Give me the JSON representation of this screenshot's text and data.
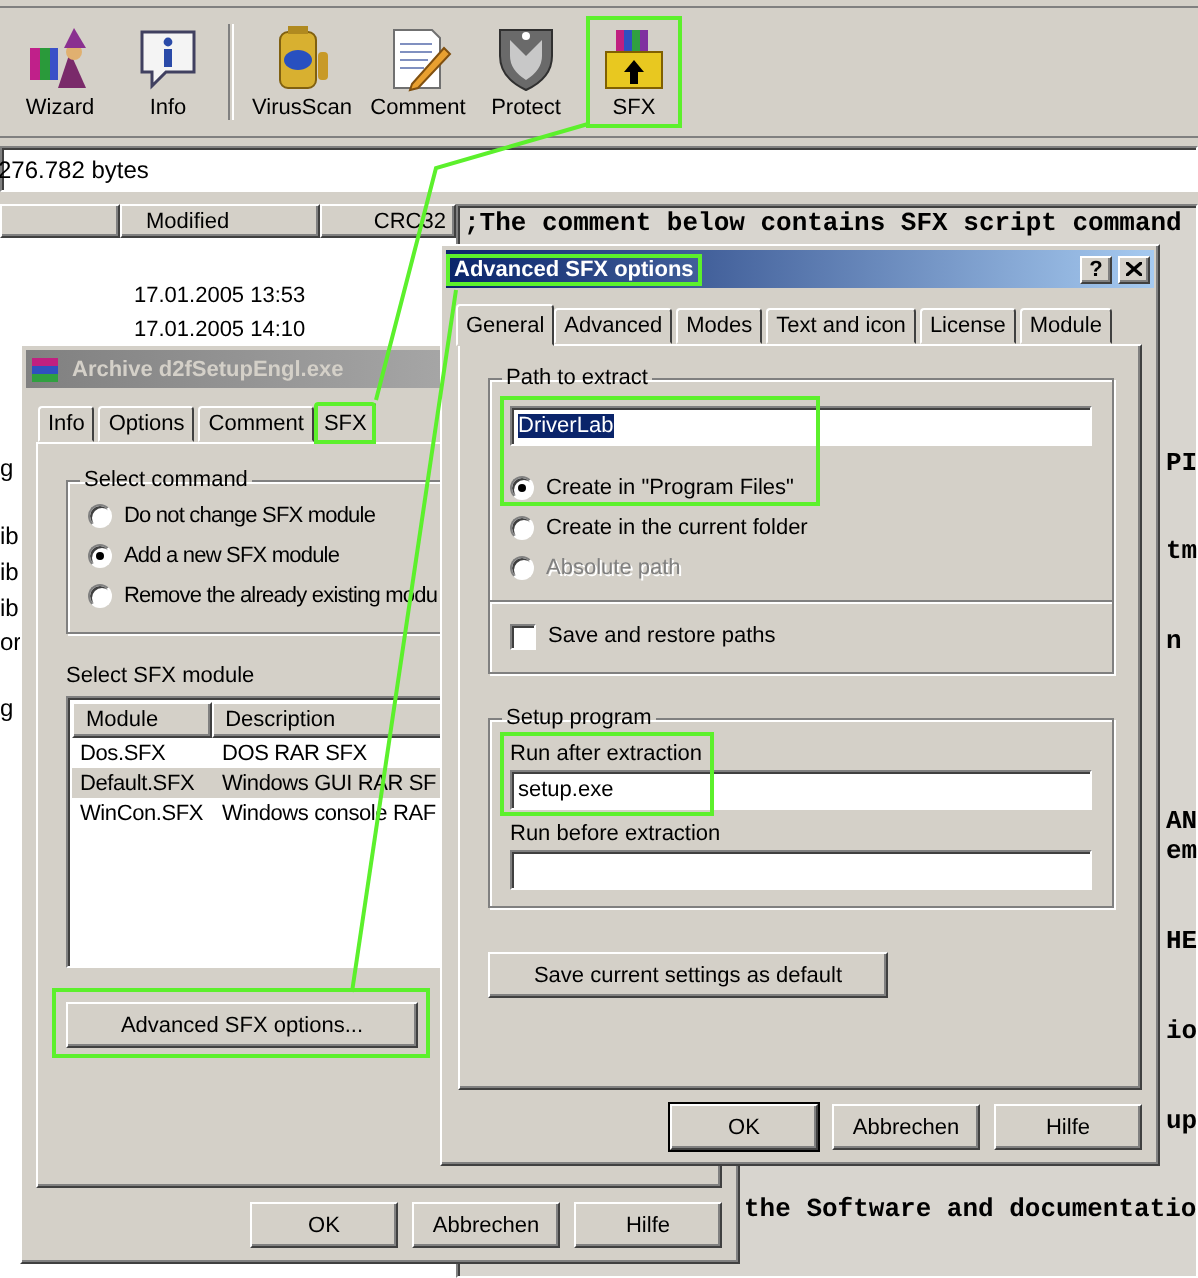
{
  "toolbar": {
    "groups": [
      {
        "buttons": [
          {
            "kind": "wizard",
            "label": "Wizard",
            "highlighted": false
          },
          {
            "kind": "info",
            "label": "Info",
            "highlighted": false
          }
        ]
      },
      {
        "buttons": [
          {
            "kind": "virusscan",
            "label": "VirusScan",
            "highlighted": false
          },
          {
            "kind": "comment",
            "label": "Comment",
            "highlighted": false
          },
          {
            "kind": "protect",
            "label": "Protect",
            "highlighted": false
          },
          {
            "kind": "sfx",
            "label": "SFX",
            "highlighted": true
          }
        ]
      }
    ]
  },
  "info_bar": {
    "text": "276.782 bytes"
  },
  "file_list": {
    "columns": [
      "Modified",
      "CRC32"
    ],
    "rows": [
      {
        "modified": "17.01.2005 13:53"
      },
      {
        "modified": "17.01.2005 14:10"
      }
    ],
    "cut_names": [
      "g",
      "ib",
      "ib",
      "ib",
      "or",
      "g"
    ]
  },
  "comment": {
    "first_line": ";The comment below contains SFX script command",
    "cut_lines": [
      "PI",
      "tm",
      "n",
      "AN",
      "em",
      "HE",
      "io",
      "up"
    ],
    "last_line": "the Software and documentatio"
  },
  "archive_dialog": {
    "title": "Archive d2fSetupEngl.exe",
    "active": false,
    "tabs": [
      {
        "label": "Info",
        "selected": false,
        "highlighted": false
      },
      {
        "label": "Options",
        "selected": false,
        "highlighted": false
      },
      {
        "label": "Comment",
        "selected": false,
        "highlighted": false
      },
      {
        "label": "SFX",
        "selected": true,
        "highlighted": true
      }
    ],
    "command_group": {
      "title": "Select command",
      "options": [
        {
          "label": "Do not change SFX module",
          "selected": false
        },
        {
          "label": "Add a new SFX module",
          "selected": true
        },
        {
          "label": "Remove the already existing modu",
          "selected": false
        }
      ]
    },
    "module_label": "Select SFX module",
    "module_list": {
      "columns": [
        "Module",
        "Description"
      ],
      "rows": [
        {
          "module": "Dos.SFX",
          "description": "DOS RAR SFX",
          "selected": false
        },
        {
          "module": "Default.SFX",
          "description": "Windows GUI RAR SF",
          "selected": true
        },
        {
          "module": "WinCon.SFX",
          "description": "Windows console RAF",
          "selected": false
        }
      ]
    },
    "advanced_button": {
      "label": "Advanced SFX options...",
      "highlighted": true
    },
    "buttons": [
      {
        "label": "OK",
        "default": false
      },
      {
        "label": "Abbrechen",
        "default": false
      },
      {
        "label": "Hilfe",
        "default": false
      }
    ]
  },
  "advanced_dialog": {
    "title": "Advanced SFX options",
    "active": true,
    "title_highlighted": true,
    "help_button": "?",
    "tabs": [
      {
        "label": "General",
        "selected": true
      },
      {
        "label": "Advanced",
        "selected": false
      },
      {
        "label": "Modes",
        "selected": false
      },
      {
        "label": "Text and icon",
        "selected": false
      },
      {
        "label": "License",
        "selected": false
      },
      {
        "label": "Module",
        "selected": false
      }
    ],
    "path_group": {
      "title": "Path to extract",
      "value": "DriverLab",
      "value_selected": true,
      "highlighted": true,
      "options": [
        {
          "label": "Create in \"Program Files\"",
          "selected": true,
          "disabled": false
        },
        {
          "label": "Create in the current folder",
          "selected": false,
          "disabled": false
        },
        {
          "label": "Absolute path",
          "selected": false,
          "disabled": true
        }
      ],
      "checkbox": {
        "label": "Save and restore paths",
        "checked": false
      }
    },
    "setup_group": {
      "title": "Setup program",
      "fields": [
        {
          "label": "Run after extraction",
          "value": "setup.exe",
          "highlighted": true
        },
        {
          "label": "Run before extraction",
          "highlighted": false
        }
      ]
    },
    "save_button": "Save current settings as default",
    "buttons": [
      {
        "label": "OK",
        "default": true
      },
      {
        "label": "Abbrechen",
        "default": false
      },
      {
        "label": "Hilfe",
        "default": false
      }
    ]
  }
}
